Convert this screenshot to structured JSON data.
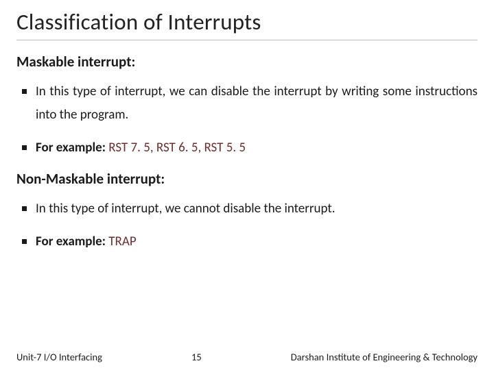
{
  "title": "Classification of Interrupts",
  "sections": [
    {
      "heading": "Maskable interrupt:",
      "bullets": [
        {
          "text": "In this type of interrupt, we can disable the interrupt by writing some instructions into the program."
        },
        {
          "prefix": "For example: ",
          "accent": "RST 7. 5, RST 6. 5, RST 5. 5",
          "bold_prefix": true
        }
      ]
    },
    {
      "heading": "Non-Maskable interrupt:",
      "bullets": [
        {
          "text": "In this type of interrupt, we cannot disable the interrupt."
        },
        {
          "prefix": "For example: ",
          "accent": "TRAP",
          "bold_prefix": true
        }
      ]
    }
  ],
  "footer": {
    "left": "Unit-7 I/O Interfacing",
    "page": "15",
    "right": "Darshan Institute of Engineering & Technology"
  }
}
